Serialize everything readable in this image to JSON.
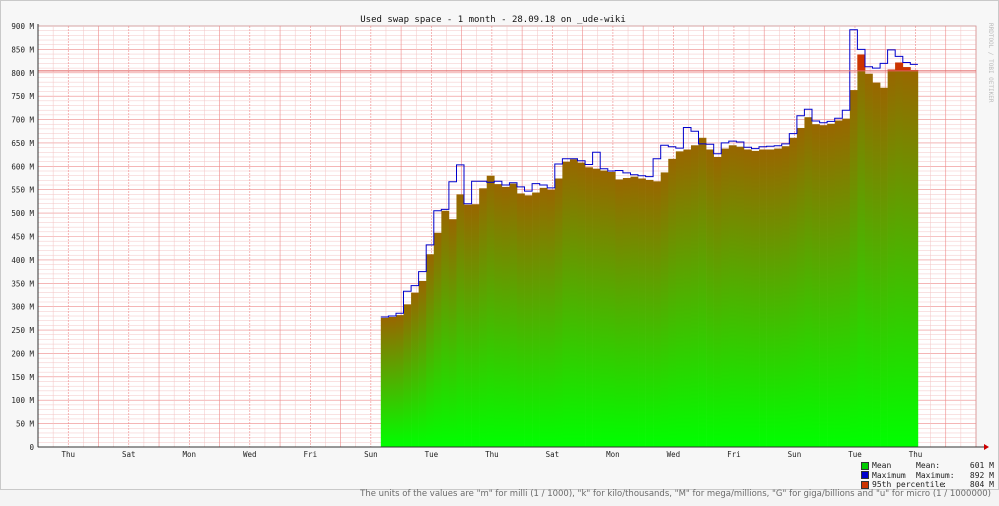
{
  "page": {
    "footer_note": "The units of the values are \"m\" for milli (1 / 1000), \"k\" for kilo/thousands, \"M\" for mega/millions, \"G\" for giga/billions and \"u\" for micro (1 / 1000000)",
    "watermark": "RRDTOOL / TOBI OETIKER"
  },
  "colors": {
    "mean_bottom": "#00ff00",
    "mean_top": "#996600",
    "max_line": "#0000cc",
    "p95_fill": "#cc3300",
    "threshold": "#e06060",
    "minor_grid": "#f3c4c4",
    "major_grid": "#ee8a8a"
  },
  "legend": [
    {
      "name": "Mean",
      "label": "Mean:",
      "value": "601 M",
      "color": "#00cc00"
    },
    {
      "name": "Maximum",
      "label": "Maximum:",
      "value": "892 M",
      "color": "#0000cc"
    },
    {
      "name": "95th percentile",
      "label": ":",
      "value": "804 M",
      "color": "#cc3300"
    }
  ],
  "chart_data": {
    "type": "area",
    "title": "Used swap space - 1 month - 28.09.18 on _ude-wiki",
    "y_unit": "M",
    "ylim": [
      0,
      900
    ],
    "y_ticks": [
      0,
      50,
      100,
      150,
      200,
      250,
      300,
      350,
      400,
      450,
      500,
      550,
      600,
      650,
      700,
      750,
      800,
      850,
      900
    ],
    "y_tick_labels": [
      "0",
      "50 M",
      "100 M",
      "150 M",
      "200 M",
      "250 M",
      "300 M",
      "350 M",
      "400 M",
      "450 M",
      "500 M",
      "550 M",
      "600 M",
      "650 M",
      "700 M",
      "750 M",
      "800 M",
      "850 M",
      "900 M"
    ],
    "x_tick_labels": [
      "Thu",
      "Sat",
      "Mon",
      "Wed",
      "Fri",
      "Sun",
      "Tue",
      "Thu",
      "Sat",
      "Mon",
      "Wed",
      "Fri",
      "Sun",
      "Tue",
      "Thu"
    ],
    "x_range_days": [
      0,
      31
    ],
    "x_tick_days": [
      1,
      3,
      5,
      7,
      9,
      11,
      13,
      15,
      17,
      19,
      21,
      23,
      25,
      27,
      29
    ],
    "bin_days": 0.25,
    "data_start_day": 11.33,
    "mean": [
      276,
      278,
      282,
      305,
      330,
      355,
      412,
      458,
      505,
      487,
      540,
      518,
      519,
      553,
      580,
      562,
      556,
      563,
      542,
      538,
      544,
      554,
      550,
      574,
      610,
      615,
      608,
      598,
      595,
      591,
      588,
      572,
      575,
      578,
      574,
      571,
      568,
      587,
      616,
      632,
      636,
      645,
      661,
      636,
      620,
      638,
      645,
      642,
      636,
      633,
      636,
      636,
      638,
      643,
      661,
      682,
      705,
      690,
      688,
      691,
      698,
      702,
      763,
      839,
      798,
      779,
      768,
      807,
      822,
      812,
      806
    ],
    "maximum": [
      278,
      280,
      286,
      333,
      345,
      375,
      432,
      505,
      508,
      567,
      603,
      520,
      568,
      568,
      566,
      568,
      560,
      565,
      556,
      547,
      563,
      560,
      554,
      605,
      616,
      616,
      612,
      604,
      630,
      595,
      590,
      591,
      586,
      582,
      580,
      578,
      616,
      645,
      642,
      639,
      683,
      675,
      648,
      647,
      627,
      650,
      654,
      652,
      641,
      638,
      642,
      643,
      644,
      648,
      670,
      708,
      722,
      697,
      693,
      696,
      703,
      720,
      892,
      850,
      813,
      810,
      820,
      849,
      835,
      822,
      818
    ],
    "percentile_95": 804
  }
}
